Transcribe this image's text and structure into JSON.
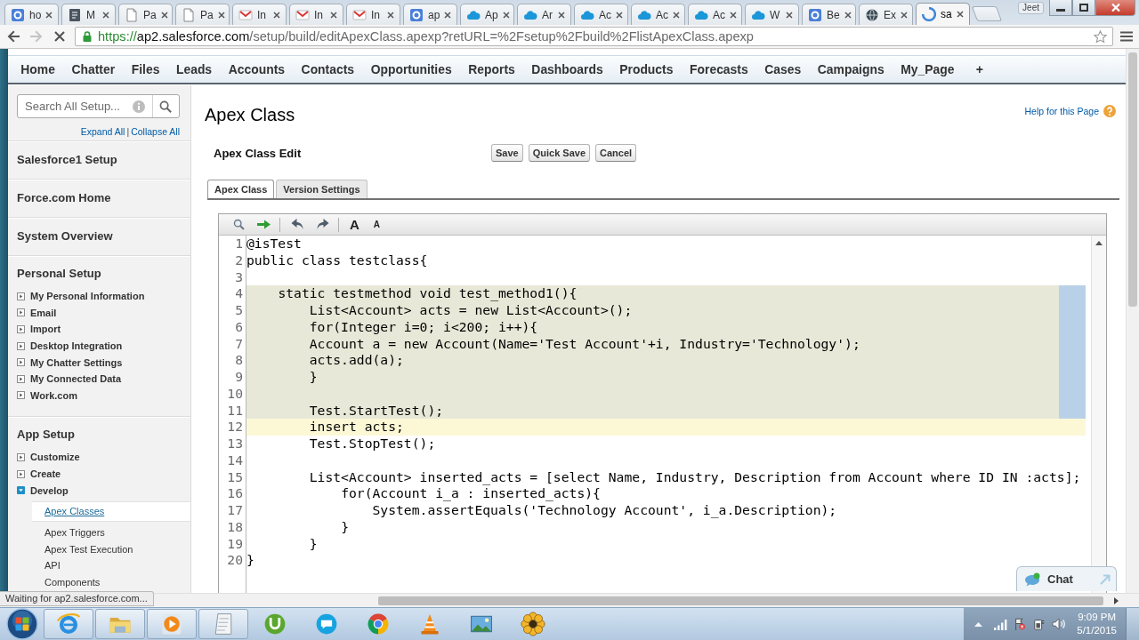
{
  "browser": {
    "tabs": [
      {
        "title": "ho",
        "kind": "square",
        "selected": false,
        "loading": false
      },
      {
        "title": "M",
        "kind": "book",
        "selected": false,
        "loading": false
      },
      {
        "title": "Pa",
        "kind": "page",
        "selected": false,
        "loading": false
      },
      {
        "title": "Pa",
        "kind": "page",
        "selected": false,
        "loading": false
      },
      {
        "title": "In",
        "kind": "mail",
        "selected": false,
        "loading": false
      },
      {
        "title": "In",
        "kind": "mail",
        "selected": false,
        "loading": false
      },
      {
        "title": "In",
        "kind": "mail",
        "selected": false,
        "loading": false
      },
      {
        "title": "ap",
        "kind": "square",
        "selected": false,
        "loading": false
      },
      {
        "title": "Ap",
        "kind": "cloud",
        "selected": false,
        "loading": false
      },
      {
        "title": "Ar",
        "kind": "cloud",
        "selected": false,
        "loading": false
      },
      {
        "title": "Ac",
        "kind": "cloud",
        "selected": false,
        "loading": false
      },
      {
        "title": "Ac",
        "kind": "cloud",
        "selected": false,
        "loading": false
      },
      {
        "title": "Ac",
        "kind": "cloud",
        "selected": false,
        "loading": false
      },
      {
        "title": "W",
        "kind": "cloud",
        "selected": false,
        "loading": false
      },
      {
        "title": "Be",
        "kind": "square",
        "selected": false,
        "loading": false
      },
      {
        "title": "Ex",
        "kind": "globe",
        "selected": false,
        "loading": false
      },
      {
        "title": "sa",
        "selected": true,
        "loading": true
      }
    ],
    "profile": "Jeet"
  },
  "address_bar": {
    "forward_disabled": true,
    "secure": true,
    "scheme": "https://",
    "host": "ap2.salesforce.com",
    "path": "/setup/build/editApexClass.apexp?retURL=%2Fsetup%2Fbuild%2FlistApexClass.apexp"
  },
  "nav": {
    "tabs": [
      {
        "label": "Home",
        "selected": false
      },
      {
        "label": "Chatter",
        "selected": false
      },
      {
        "label": "Files",
        "selected": false
      },
      {
        "label": "Leads",
        "selected": false
      },
      {
        "label": "Accounts",
        "selected": false
      },
      {
        "label": "Contacts",
        "selected": false
      },
      {
        "label": "Opportunities",
        "selected": false
      },
      {
        "label": "Reports",
        "selected": false
      },
      {
        "label": "Dashboards",
        "selected": false
      },
      {
        "label": "Products",
        "selected": false
      },
      {
        "label": "Forecasts",
        "selected": false
      },
      {
        "label": "Cases",
        "selected": false
      },
      {
        "label": "Campaigns",
        "selected": false
      },
      {
        "label": "My_Page",
        "selected": false
      }
    ],
    "more": "+"
  },
  "sidebar": {
    "search": {
      "placeholder": "Search All Setup..."
    },
    "links": {
      "expand": "Expand All",
      "separator": "|",
      "collapse": "Collapse All"
    },
    "sections": [
      {
        "title": "Salesforce1 Setup"
      },
      {
        "title": "Force.com Home"
      },
      {
        "title": "System Overview"
      },
      {
        "title": "Personal Setup",
        "items": [
          {
            "label": "My Personal Information",
            "expanded": false
          },
          {
            "label": "Email",
            "expanded": false
          },
          {
            "label": "Import",
            "expanded": false
          },
          {
            "label": "Desktop Integration",
            "expanded": false
          },
          {
            "label": "My Chatter Settings",
            "expanded": false
          },
          {
            "label": "My Connected Data",
            "expanded": false
          },
          {
            "label": "Work.com",
            "expanded": false
          }
        ]
      },
      {
        "title": "App Setup",
        "items": [
          {
            "label": "Customize",
            "expanded": false
          },
          {
            "label": "Create",
            "expanded": false
          },
          {
            "label": "Develop",
            "expanded": true,
            "children": [
              {
                "label": "Apex Classes",
                "selected": true
              },
              {
                "label": "Apex Triggers",
                "selected": false
              },
              {
                "label": "Apex Test Execution",
                "selected": false
              },
              {
                "label": "API",
                "selected": false
              },
              {
                "label": "Components",
                "selected": false
              }
            ]
          }
        ]
      }
    ]
  },
  "main": {
    "title": "Apex Class",
    "help_link": "Help for this Page",
    "edit": {
      "title": "Apex Class Edit",
      "buttons": [
        "Save",
        "Quick Save",
        "Cancel"
      ]
    },
    "tabs": [
      {
        "label": "Apex Class",
        "selected": true
      },
      {
        "label": "Version Settings",
        "selected": false
      }
    ],
    "editor": {
      "toolbar": {
        "font_buttons": [
          {
            "label": "A",
            "kind": "larger"
          },
          {
            "label": "A",
            "kind": "smaller"
          }
        ]
      },
      "lines": [
        {
          "number": "1",
          "text": "@isTest",
          "selected": false,
          "current": false
        },
        {
          "number": "2",
          "text": "public class testclass{",
          "selected": false,
          "current": false
        },
        {
          "number": "3",
          "selected": false,
          "current": false
        },
        {
          "number": "4",
          "text": "    static testmethod void test_method1(){",
          "selected": true,
          "current": false
        },
        {
          "number": "5",
          "text": "        List<Account> acts = new List<Account>();",
          "selected": true,
          "current": false
        },
        {
          "number": "6",
          "text": "        for(Integer i=0; i<200; i++){",
          "selected": true,
          "current": false
        },
        {
          "number": "7",
          "text": "        Account a = new Account(Name='Test Account'+i, Industry='Technology');",
          "selected": true,
          "current": false
        },
        {
          "number": "8",
          "text": "        acts.add(a);",
          "selected": true,
          "current": false
        },
        {
          "number": "9",
          "text": "        }",
          "selected": true,
          "current": false
        },
        {
          "number": "10",
          "selected": true,
          "current": false
        },
        {
          "number": "11",
          "text": "        Test.StartTest();",
          "selected": true,
          "current": false
        },
        {
          "number": "12",
          "text": "        insert acts;",
          "selected": false,
          "current": true
        },
        {
          "number": "13",
          "text": "        Test.StopTest();",
          "selected": false,
          "current": false
        },
        {
          "number": "14",
          "selected": false,
          "current": false
        },
        {
          "number": "15",
          "text": "        List<Account> inserted_acts = [select Name, Industry, Description from Account where ID IN :acts];",
          "selected": false,
          "current": false
        },
        {
          "number": "16",
          "text": "            for(Account i_a : inserted_acts){",
          "selected": false,
          "current": false
        },
        {
          "number": "17",
          "text": "                System.assertEquals('Technology Account', i_a.Description);",
          "selected": false,
          "current": false
        },
        {
          "number": "18",
          "text": "            }",
          "selected": false,
          "current": false
        },
        {
          "number": "19",
          "text": "        }",
          "selected": false,
          "current": false
        },
        {
          "number": "20",
          "text": "}",
          "selected": false,
          "current": false
        }
      ]
    }
  },
  "chat": {
    "label": "Chat"
  },
  "status_bubble": "Waiting for ap2.salesforce.com...",
  "taskbar": {
    "time": "9:09 PM",
    "date": "5/1/2015"
  }
}
